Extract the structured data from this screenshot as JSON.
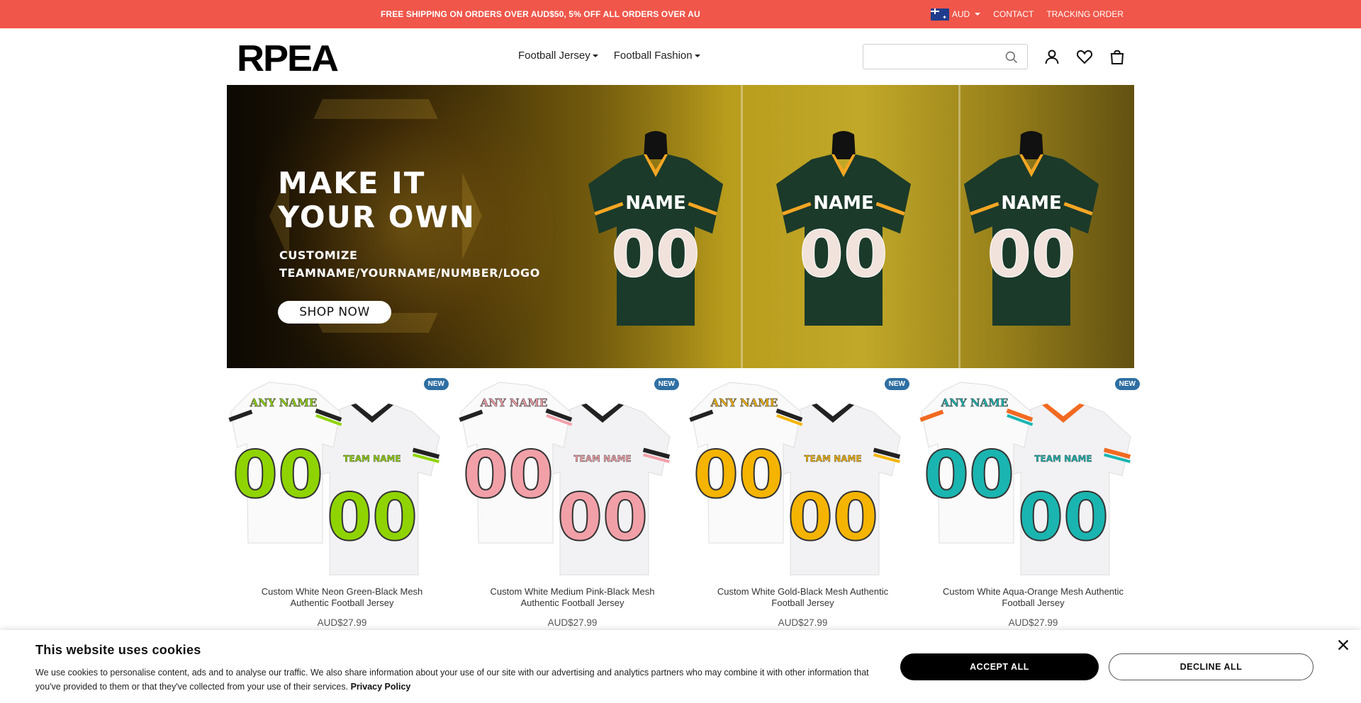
{
  "topbar": {
    "promo": "FREE SHIPPING ON ORDERS OVER AUD$50, 5% OFF ALL ORDERS OVER AU",
    "currency": "AUD",
    "contact": "CONTACT",
    "tracking": "TRACKING ORDER",
    "bg_color": "#f0564a"
  },
  "header": {
    "logo": "RPEA",
    "nav": [
      {
        "label": "Football Jersey"
      },
      {
        "label": "Football Fashion"
      }
    ],
    "search_placeholder": ""
  },
  "hero": {
    "title_line1": "MAKE IT",
    "title_line2": "YOUR OWN",
    "subtitle_line1": "CUSTOMIZE",
    "subtitle_line2": "TEAMNAME/YOURNAME/NUMBER/LOGO",
    "cta": "SHOP NOW",
    "jersey_name": "NAME",
    "jersey_number": "00"
  },
  "products": [
    {
      "badge": "NEW",
      "title": "Custom White Neon Green-Black Mesh Authentic Football Jersey",
      "price": "AUD$27.99",
      "accent": "#8fd400",
      "trim": "#222222",
      "front_text": "ANY NAME",
      "back_text": "TEAM NAME",
      "number": "00"
    },
    {
      "badge": "NEW",
      "title": "Custom White Medium Pink-Black Mesh Authentic Football Jersey",
      "price": "AUD$27.99",
      "accent": "#f2a0a8",
      "trim": "#222222",
      "front_text": "ANY NAME",
      "back_text": "TEAM NAME",
      "number": "00"
    },
    {
      "badge": "NEW",
      "title": "Custom White Gold-Black Mesh Authentic Football Jersey",
      "price": "AUD$27.99",
      "accent": "#f5b400",
      "trim": "#222222",
      "front_text": "ANY NAME",
      "back_text": "TEAM NAME",
      "number": "00"
    },
    {
      "badge": "NEW",
      "title": "Custom White Aqua-Orange Mesh Authentic Football Jersey",
      "price": "AUD$27.99",
      "accent": "#1ab5b0",
      "trim": "#f26a21",
      "front_text": "ANY NAME",
      "back_text": "TEAM NAME",
      "number": "00"
    }
  ],
  "cookie": {
    "title": "This website uses cookies",
    "text": "We use cookies to personalise content, ads and to analyse our traffic. We also share information about your use of our site with our advertising and analytics partners who may combine it with other information that you've provided to them or that they've collected from your use of their services.",
    "policy_link": "Privacy Policy",
    "accept": "ACCEPT ALL",
    "decline": "DECLINE ALL"
  }
}
